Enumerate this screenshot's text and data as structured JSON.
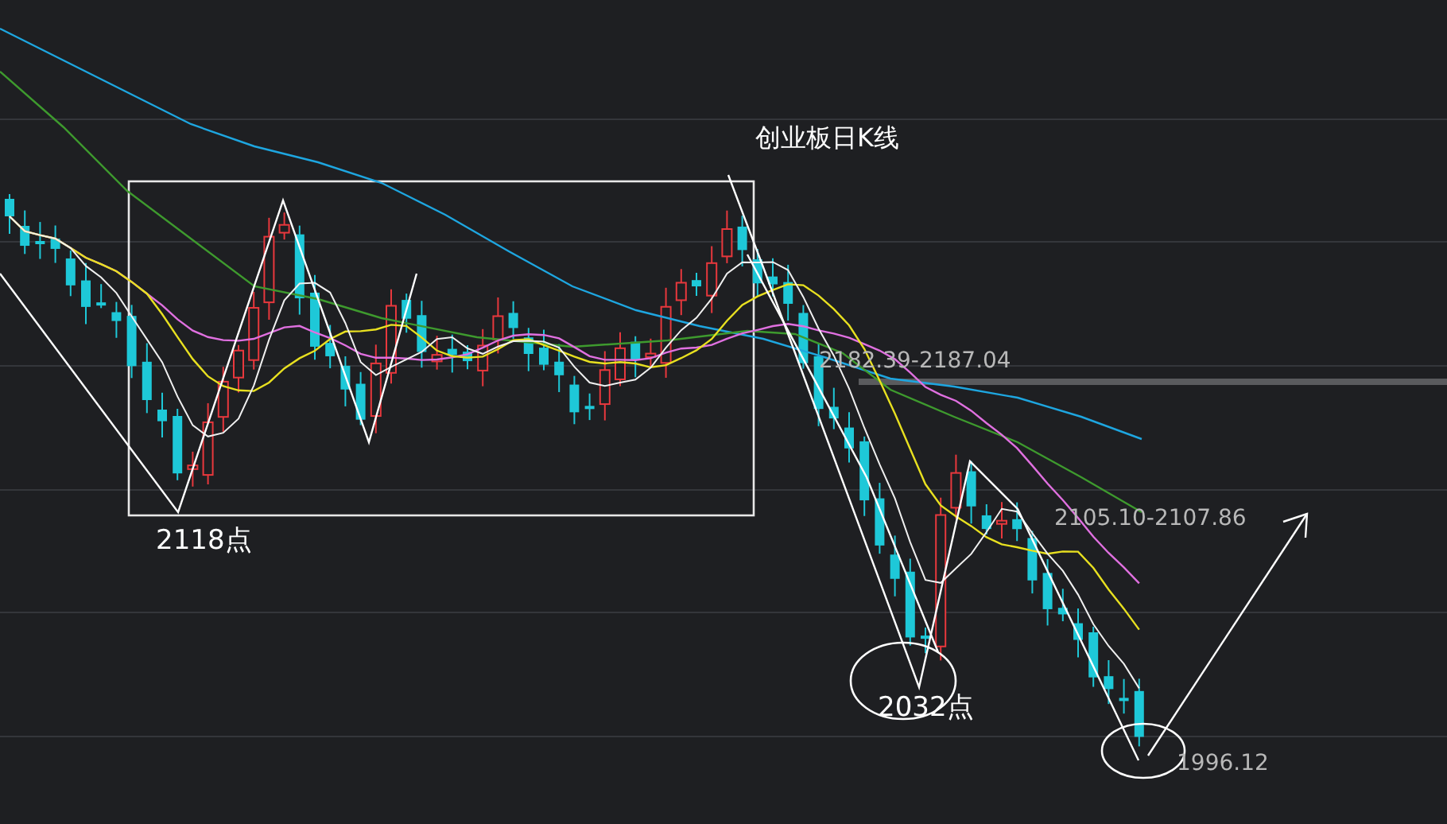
{
  "title": "创业板日K线",
  "labels": [
    {
      "kind": "level",
      "text": "2182.39-2187.04"
    },
    {
      "kind": "point",
      "text": "2118点"
    },
    {
      "kind": "level",
      "text": "2105.10-2107.86"
    },
    {
      "kind": "point",
      "text": "2032点"
    },
    {
      "kind": "level",
      "text": "1996.12"
    }
  ]
}
